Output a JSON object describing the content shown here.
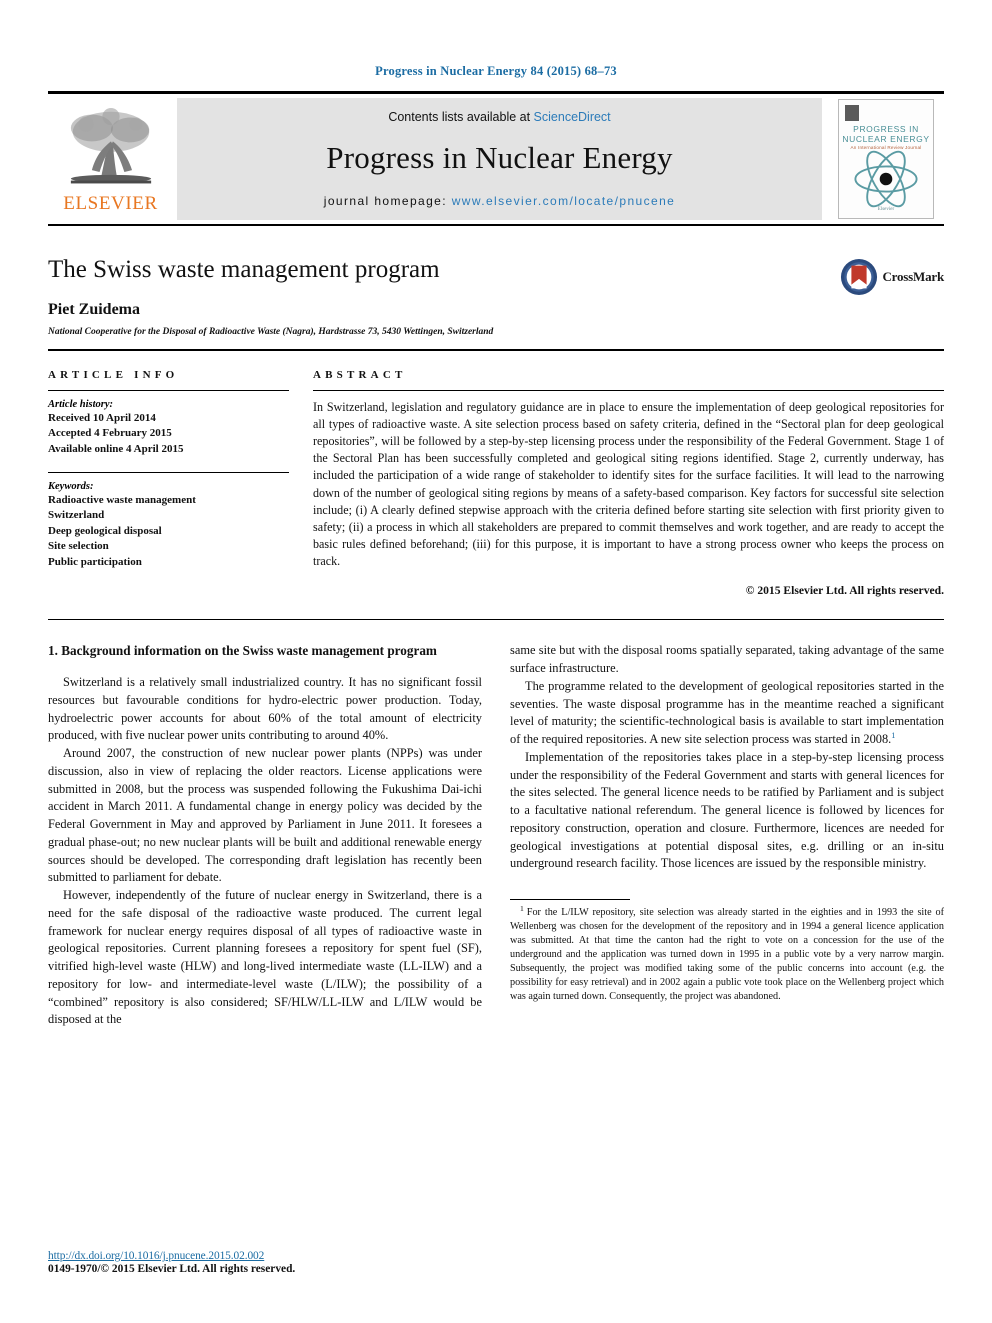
{
  "running_head": "Progress in Nuclear Energy 84 (2015) 68–73",
  "masthead": {
    "publisher_name": "ELSEVIER",
    "contents_prefix": "Contents lists available at ",
    "contents_link": "ScienceDirect",
    "journal_title": "Progress in Nuclear Energy",
    "homepage_prefix": "journal homepage: ",
    "homepage_url": "www.elsevier.com/locate/pnucene",
    "cover": {
      "line1": "PROGRESS IN",
      "line2": "NUCLEAR ENERGY",
      "line3": "An International Review Journal",
      "footer": "Elsevier",
      "atom_color": "#5a9ba3"
    }
  },
  "article": {
    "title": "The Swiss waste management program",
    "author": "Piet Zuidema",
    "affiliation": "National Cooperative for the Disposal of Radioactive Waste (Nagra), Hardstrasse 73, 5430 Wettingen, Switzerland",
    "crossmark_label": "CrossMark"
  },
  "article_info": {
    "heading": "ARTICLE INFO",
    "history_heading": "Article history:",
    "history": [
      "Received 10 April 2014",
      "Accepted 4 February 2015",
      "Available online 4 April 2015"
    ],
    "keywords_heading": "Keywords:",
    "keywords": [
      "Radioactive waste management",
      "Switzerland",
      "Deep geological disposal",
      "Site selection",
      "Public participation"
    ]
  },
  "abstract": {
    "heading": "ABSTRACT",
    "text": "In Switzerland, legislation and regulatory guidance are in place to ensure the implementation of deep geological repositories for all types of radioactive waste. A site selection process based on safety criteria, defined in the “Sectoral plan for deep geological repositories”, will be followed by a step-by-step licensing process under the responsibility of the Federal Government. Stage 1 of the Sectoral Plan has been successfully completed and geological siting regions identified. Stage 2, currently underway, has included the participation of a wide range of stakeholder to identify sites for the surface facilities. It will lead to the narrowing down of the number of geological siting regions by means of a safety-based comparison. Key factors for successful site selection include; (i) A clearly defined stepwise approach with the criteria defined before starting site selection with first priority given to safety; (ii) a process in which all stakeholders are prepared to commit themselves and work together, and are ready to accept the basic rules defined beforehand; (iii) for this purpose, it is important to have a strong process owner who keeps the process on track.",
    "copyright": "© 2015 Elsevier Ltd. All rights reserved."
  },
  "body": {
    "section_title": "1. Background information on the Swiss waste management program",
    "left_paragraphs": [
      "Switzerland is a relatively small industrialized country. It has no significant fossil resources but favourable conditions for hydro-electric power production. Today, hydroelectric power accounts for about 60% of the total amount of electricity produced, with five nuclear power units contributing to around 40%.",
      "Around 2007, the construction of new nuclear power plants (NPPs) was under discussion, also in view of replacing the older reactors. License applications were submitted in 2008, but the process was suspended following the Fukushima Dai-ichi accident in March 2011. A fundamental change in energy policy was decided by the Federal Government in May and approved by Parliament in June 2011. It foresees a gradual phase-out; no new nuclear plants will be built and additional renewable energy sources should be developed. The corresponding draft legislation has recently been submitted to parliament for debate.",
      "However, independently of the future of nuclear energy in Switzerland, there is a need for the safe disposal of the radioactive waste produced. The current legal framework for nuclear energy requires disposal of all types of radioactive waste in geological repositories. Current planning foresees a repository for spent fuel (SF), vitrified high-level waste (HLW) and long-lived intermediate waste (LL-ILW) and a repository for low- and intermediate-level waste (L/ILW); the possibility of a “combined” repository is also considered; SF/HLW/LL-ILW and L/ILW would be disposed at the"
    ],
    "right_paragraph_continued": "same site but with the disposal rooms spatially separated, taking advantage of the same surface infrastructure.",
    "right_paragraphs": [
      "The programme related to the development of geological repositories started in the seventies. The waste disposal programme has in the meantime reached a significant level of maturity; the scientific-technological basis is available to start implementation of the required repositories. A new site selection process was started in 2008.",
      "Implementation of the repositories takes place in a step-by-step licensing process under the responsibility of the Federal Government and starts with general licences for the sites selected. The general licence needs to be ratified by Parliament and is subject to a facultative national referendum. The general licence is followed by licences for repository construction, operation and closure. Furthermore, licences are needed for geological investigations at potential disposal sites, e.g. drilling or an in-situ underground research facility. Those licences are issued by the responsible ministry."
    ],
    "footnote_marker": "1",
    "footnote": "For the L/ILW repository, site selection was already started in the eighties and in 1993 the site of Wellenberg was chosen for the development of the repository and in 1994 a general licence application was submitted. At that time the canton had the right to vote on a concession for the use of the underground and the application was turned down in 1995 in a public vote by a very narrow margin. Subsequently, the project was modified taking some of the public concerns into account (e.g. the possibility for easy retrieval) and in 2002 again a public vote took place on the Wellenberg project which was again turned down. Consequently, the project was abandoned."
  },
  "footer": {
    "doi": "http://dx.doi.org/10.1016/j.pnucene.2015.02.002",
    "issn_copyright": "0149-1970/© 2015 Elsevier Ltd. All rights reserved."
  }
}
